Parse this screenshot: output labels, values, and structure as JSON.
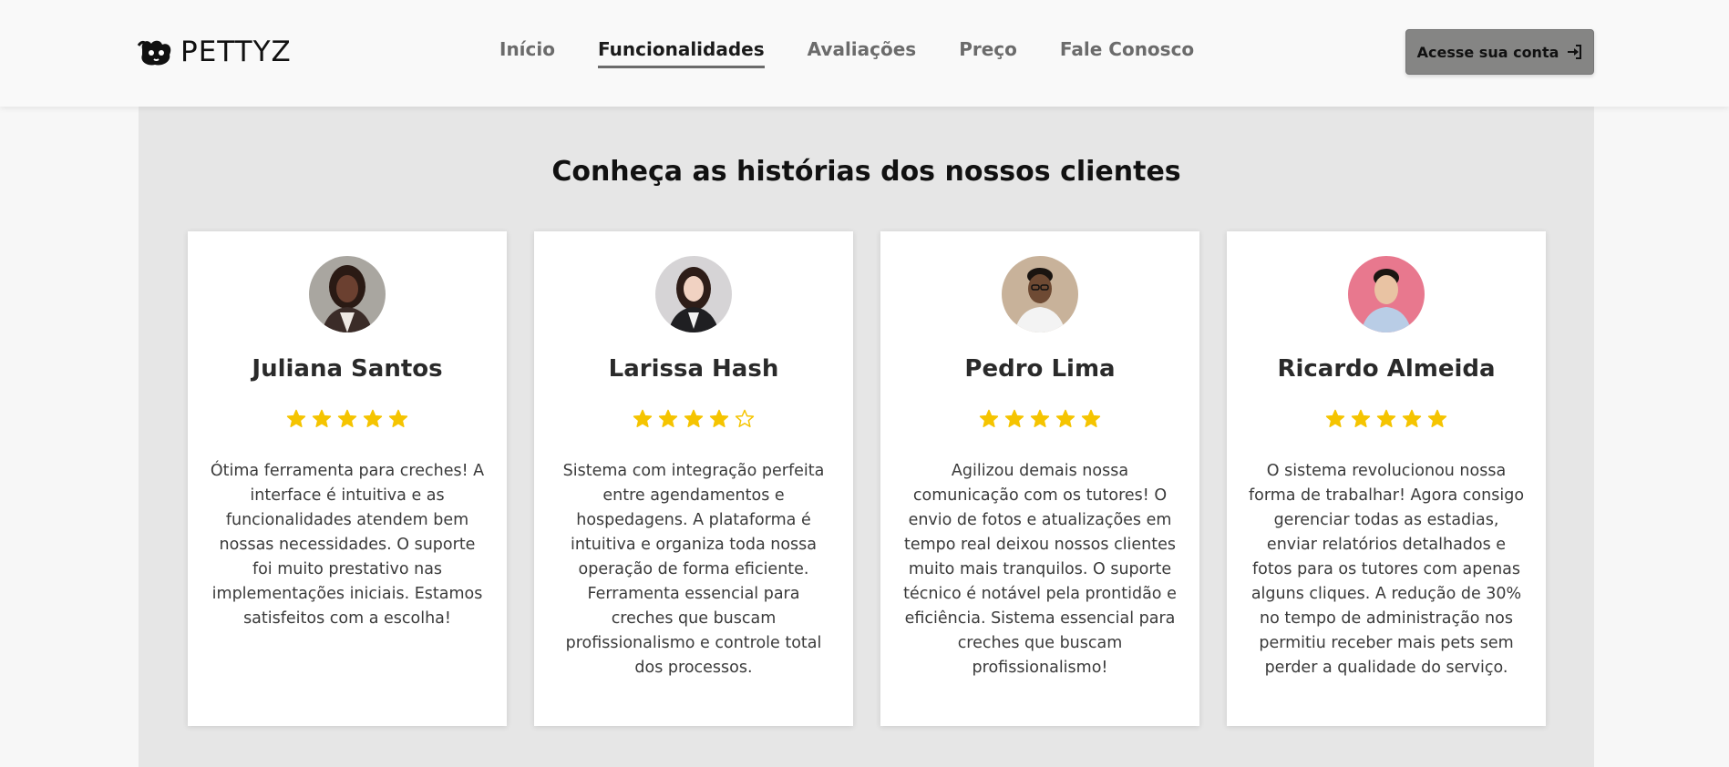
{
  "header": {
    "logo_text": "PETTYZ",
    "logo_icon": "dog-logo-icon",
    "nav": [
      {
        "label": "Início",
        "active": false
      },
      {
        "label": "Funcionalidades",
        "active": true
      },
      {
        "label": "Avaliações",
        "active": false
      },
      {
        "label": "Preço",
        "active": false
      },
      {
        "label": "Fale Conosco",
        "active": false
      }
    ],
    "account_button": {
      "label": "Acesse sua conta",
      "icon": "sign-in-icon"
    }
  },
  "testimonials": {
    "title": "Conheça as histórias dos nossos clientes",
    "star_color": "#f5c400",
    "cards": [
      {
        "name": "Juliana Santos",
        "rating": 5,
        "text": "Ótima ferramenta para creches! A interface é intuitiva e as funcionalidades atendem bem nossas necessidades. O suporte foi muito prestativo nas implementações iniciais. Estamos satisfeitos com a escolha!"
      },
      {
        "name": "Larissa Hash",
        "rating": 4,
        "text": "Sistema com integração perfeita entre agendamentos e hospedagens. A plataforma é intuitiva e organiza toda nossa operação de forma eficiente. Ferramenta essencial para creches que buscam profissionalismo e controle total dos processos."
      },
      {
        "name": "Pedro Lima",
        "rating": 5,
        "text": "Agilizou demais nossa comunicação com os tutores! O envio de fotos e atualizações em tempo real deixou nossos clientes muito mais tranquilos. O suporte técnico é notável pela prontidão e eficiência. Sistema essencial para creches que buscam profissionalismo!"
      },
      {
        "name": "Ricardo Almeida",
        "rating": 5,
        "text": "O sistema revolucionou nossa forma de trabalhar! Agora consigo gerenciar todas as estadias, enviar relatórios detalhados e fotos para os tutores com apenas alguns cliques. A redução de 30% no tempo de administração nos permitiu receber mais pets sem perder a qualidade do serviço."
      }
    ]
  }
}
